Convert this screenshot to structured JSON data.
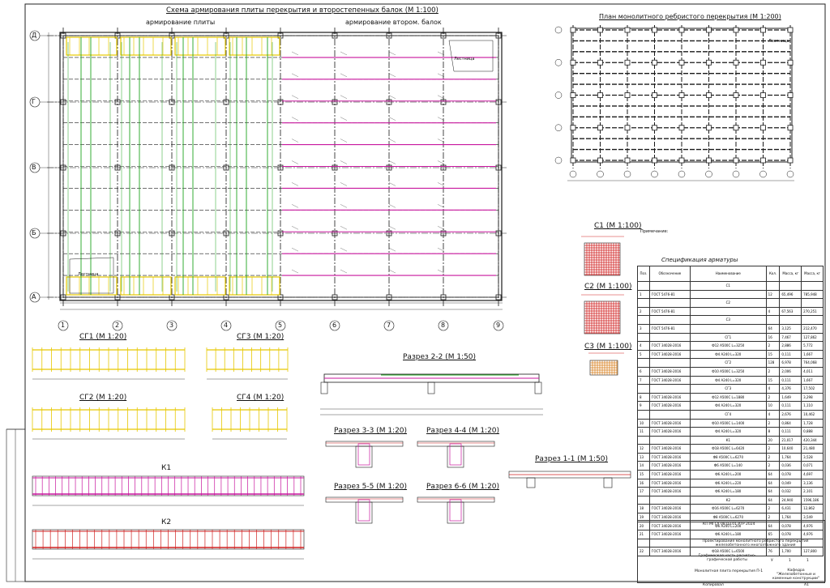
{
  "views": {
    "plan_rebar_title": "Схема армирования плиты перекрытия и второстепенных балок (М 1:100)",
    "plan_rebar_sub_left": "армирование плиты",
    "plan_rebar_sub_right": "армирование втором. балок",
    "plan_mono_title": "План монолитного ребристого перекрытия (М 1:200)",
    "c1_title": "С1 (М 1:100)",
    "c2_title": "С2 (М 1:100)",
    "c3_title": "С3 (М 1:100)",
    "spec_title": "Спецификация арматуры",
    "sg1_title": "СГ1 (М 1:20)",
    "sg2_title": "СГ2 (М 1:20)",
    "sg3_title": "СГ3 (М 1:20)",
    "sg4_title": "СГ4 (М 1:20)",
    "k1_title": "К1",
    "k2_title": "К2",
    "sec22_title": "Разрез 2-2 (М 1:50)",
    "sec33_title": "Разрез 3-3 (М 1:20)",
    "sec44_title": "Разрез 4-4 (М 1:20)",
    "sec55_title": "Разрез 5-5 (М 1:20)",
    "sec66_title": "Разрез 6-6 (М 1:20)",
    "sec11_title": "Разрез 1-1 (М 1:50)",
    "notes_heading": "Примечание:"
  },
  "axes": {
    "letters": [
      "Д",
      "Г",
      "В",
      "Б",
      "А"
    ],
    "numbers": [
      "1",
      "2",
      "3",
      "4",
      "5",
      "6",
      "7",
      "8",
      "9"
    ]
  },
  "labels": {
    "stair_1": "Лестница",
    "stair_2": "Лестница",
    "stair_3": "Лестница"
  },
  "spec": {
    "headers": [
      "Поз.",
      "Обозначение",
      "Наименование",
      "Кол.",
      "Масса, кг",
      "Масса, кг"
    ],
    "rows": [
      [
        "",
        "",
        "С1",
        "",
        "",
        ""
      ],
      [
        "1",
        "ГОСТ 5476-81",
        "",
        "12",
        "65,496",
        "785,948"
      ],
      [
        "",
        "",
        "С2",
        "",
        "",
        ""
      ],
      [
        "2",
        "ГОСТ 5476-81",
        "",
        "4",
        "67,563",
        "270,251"
      ],
      [
        "",
        "",
        "С3",
        "",
        "",
        ""
      ],
      [
        "3",
        "ГОСТ 5476-81",
        "",
        "64",
        "3,125",
        "212,470"
      ],
      [
        "",
        "",
        "СГ1",
        "16",
        "7,467",
        "127,862"
      ],
      [
        "4",
        "ГОСТ 34028-2016",
        "Ф12 A500C L=3250",
        "2",
        "2,886",
        "5,772"
      ],
      [
        "5",
        "ГОСТ 34028-2016",
        "Ф4 A240 L=320",
        "15",
        "0,111",
        "1,667"
      ],
      [
        "",
        "",
        "СГ2",
        "128",
        "6,978",
        "764,068"
      ],
      [
        "6",
        "ГОСТ 34028-2016",
        "Ф10 A500C L=3250",
        "2",
        "2,006",
        "4,011"
      ],
      [
        "7",
        "ГОСТ 34028-2016",
        "Ф4 A240 L=320",
        "15",
        "0,111",
        "1,667"
      ],
      [
        "",
        "",
        "СГ3",
        "4",
        "4,376",
        "17,502"
      ],
      [
        "8",
        "ГОСТ 34028-2016",
        "Ф12 A500C L=1880",
        "2",
        "1,649",
        "3,298"
      ],
      [
        "9",
        "ГОСТ 34028-2016",
        "Ф4 A240 L=320",
        "10",
        "0,111",
        "1,110"
      ],
      [
        "",
        "",
        "СГ4",
        "4",
        "2,676",
        "10,462"
      ],
      [
        "10",
        "ГОСТ 34028-2016",
        "Ф10 A500C L=1400",
        "2",
        "0,864",
        "1,728"
      ],
      [
        "11",
        "ГОСТ 34028-2016",
        "Ф4 A240 L=320",
        "8",
        "0,111",
        "0,888"
      ],
      [
        "",
        "",
        "К1",
        "20",
        "21,017",
        "420,344"
      ],
      [
        "12",
        "ГОСТ 34028-2016",
        "Ф18 A500C L=6420",
        "2",
        "10,640",
        "21,480"
      ],
      [
        "13",
        "ГОСТ 34028-2016",
        "Ф8 A500C L=6270",
        "2",
        "1,764",
        "3,528"
      ],
      [
        "14",
        "ГОСТ 34028-2016",
        "Ф6 A500C L=140",
        "2",
        "0,036",
        "0,071"
      ],
      [
        "15",
        "ГОСТ 34028-2016",
        "Ф6 A240 L=200",
        "64",
        "0,078",
        "4,697"
      ],
      [
        "16",
        "ГОСТ 34028-2016",
        "Ф6 A240 L=220",
        "64",
        "0,049",
        "3,136"
      ],
      [
        "17",
        "ГОСТ 34028-2016",
        "Ф6 A240 L=180",
        "64",
        "0,032",
        "2,101"
      ],
      [
        "",
        "",
        "К2",
        "64",
        "24,940",
        "1596,186"
      ],
      [
        "18",
        "ГОСТ 34028-2016",
        "Ф16 A500C L=6270",
        "2",
        "6,431",
        "12,862"
      ],
      [
        "19",
        "ГОСТ 34028-2016",
        "Ф8 A500C L=6270",
        "2",
        "1,764",
        "3,549"
      ],
      [
        "20",
        "ГОСТ 34028-2016",
        "Ф6 A240 L=200",
        "64",
        "0,078",
        "4,976"
      ],
      [
        "21",
        "ГОСТ 34028-2016",
        "Ф6 A240 L=180",
        "65",
        "0,078",
        "4,976"
      ],
      [
        "",
        "",
        "",
        "",
        "",
        ""
      ],
      [
        "22",
        "ГОСТ 34028-2016",
        "Ф18 A500C L=6500",
        "76",
        "1,700",
        "127,800"
      ]
    ]
  },
  "stamp": {
    "code": "КП МГСУ 08.03.01 РТР 2024",
    "subject": "Проектирование монолитного ребристого перекрытия железобетонного многоэтажного здания",
    "part": "Графическая часть расчетно-графической работы",
    "sheet_title": "Монолитная плита перекрытия П-1",
    "stage": "У",
    "sheet_no": "1",
    "sheets": "1",
    "org": "Кафедра \"Железобетонные и каменные конструкции\"",
    "copied": "Копировал",
    "format": "А1"
  },
  "colors": {
    "yellow": "#e6c800",
    "green": "#1fa31f",
    "magenta": "#c8169e",
    "red": "#d02020",
    "ink": "#1a1a1a"
  }
}
